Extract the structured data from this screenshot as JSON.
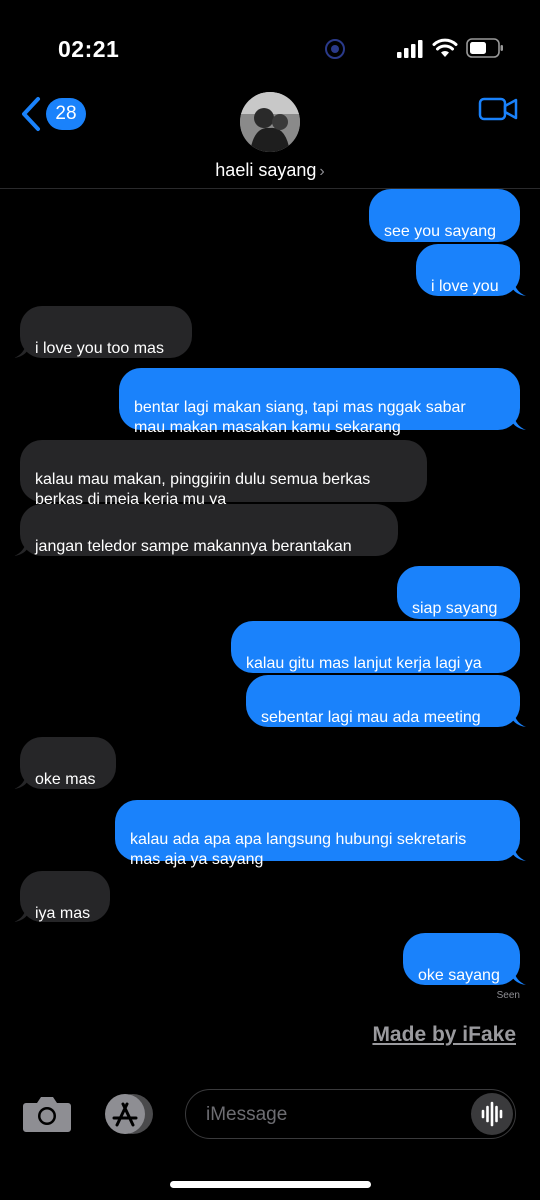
{
  "status_bar": {
    "time": "02:21"
  },
  "header": {
    "back_count": "28",
    "contact_name": "haeli sayang",
    "chevron": "›"
  },
  "messages": [
    {
      "dir": "out",
      "text": "see you sayang"
    },
    {
      "dir": "out",
      "text": "i love you"
    },
    {
      "dir": "in",
      "text": "i love you too mas"
    },
    {
      "dir": "out",
      "text": "bentar lagi makan siang, tapi mas nggak sabar\nmau makan masakan kamu sekarang"
    },
    {
      "dir": "in",
      "text": "kalau mau makan, pinggirin dulu semua berkas\nberkas di meja kerja mu ya"
    },
    {
      "dir": "in",
      "text": "jangan teledor sampe makannya berantakan"
    },
    {
      "dir": "out",
      "text": "siap sayang"
    },
    {
      "dir": "out",
      "text": "kalau gitu mas lanjut kerja lagi ya"
    },
    {
      "dir": "out",
      "text": "sebentar lagi mau ada meeting"
    },
    {
      "dir": "in",
      "text": "oke mas"
    },
    {
      "dir": "out",
      "text": "kalau ada apa apa langsung hubungi sekretaris\nmas aja ya sayang"
    },
    {
      "dir": "in",
      "text": "iya mas"
    },
    {
      "dir": "out",
      "text": "oke sayang"
    }
  ],
  "seen_label": "Seen",
  "watermark": "Made by iFake",
  "composer": {
    "placeholder": "iMessage"
  },
  "colors": {
    "outgoing": "#1a82fb",
    "incoming": "#262628",
    "background": "#000000"
  },
  "icons": [
    "focus-icon",
    "signal-icon",
    "wifi-icon",
    "battery-icon",
    "back-chevron-icon",
    "video-call-icon",
    "camera-icon",
    "app-store-icon",
    "audio-waveform-icon"
  ]
}
